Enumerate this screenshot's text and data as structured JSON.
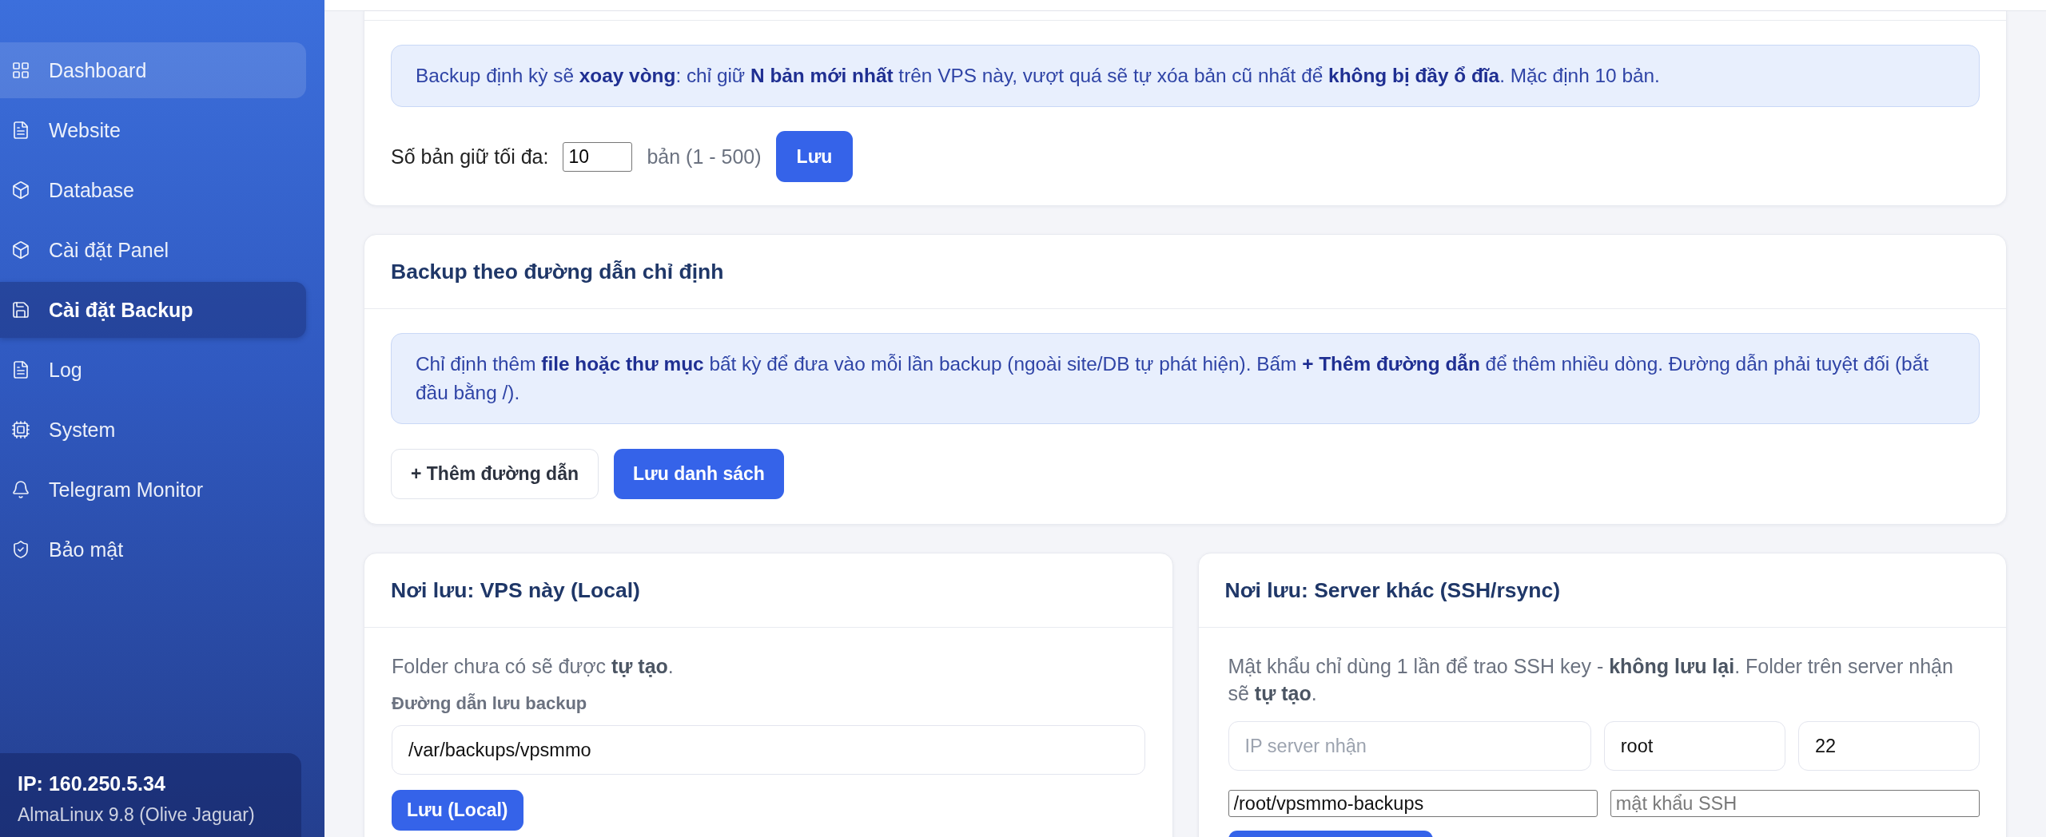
{
  "sidebar": {
    "items": [
      {
        "label": "Dashboard",
        "selected": false,
        "hovered": true
      },
      {
        "label": "Website",
        "selected": false,
        "hovered": false
      },
      {
        "label": "Database",
        "selected": false,
        "hovered": false
      },
      {
        "label": "Cài đặt Panel",
        "selected": false,
        "hovered": false
      },
      {
        "label": "Cài đặt Backup",
        "selected": true,
        "hovered": false
      },
      {
        "label": "Log",
        "selected": false,
        "hovered": false
      },
      {
        "label": "System",
        "selected": false,
        "hovered": false
      },
      {
        "label": "Telegram Monitor",
        "selected": false,
        "hovered": false
      },
      {
        "label": "Bảo mật",
        "selected": false,
        "hovered": false
      }
    ],
    "server_info": {
      "ip": "IP: 160.250.5.34",
      "os": "AlmaLinux 9.8 (Olive Jaguar)"
    }
  },
  "retention_card": {
    "notice": "Backup định kỳ sẽ **xoay vòng**: chỉ giữ **N bản mới nhất** trên VPS này, vượt quá sẽ tự xóa bản cũ nhất để **không bị đầy ổ đĩa**. Mặc định 10 bản.",
    "label": "Số bản giữ tối đa:",
    "input": {
      "value": "10"
    },
    "hint": "bản (1 - 500)",
    "button": "Lưu"
  },
  "custom_paths_card": {
    "title": "Backup theo đường dẫn chỉ định",
    "notice": "Chỉ định thêm **file hoặc thư mục** bất kỳ để đưa vào mỗi lần backup (ngoài site/DB tự phát hiện). Bấm **+ Thêm đường dẫn** để thêm nhiều dòng. Đường dẫn phải tuyệt đối (bắt đầu bằng /).",
    "buttons": [
      {
        "label": "+ Thêm đường dẫn",
        "kind": "secondary"
      },
      {
        "label": "Lưu danh sách",
        "kind": "primary"
      }
    ]
  },
  "local_card": {
    "title": "Nơi lưu: VPS này (Local)",
    "note": "Folder chưa có sẽ được **tự tạo**.",
    "field_label": "Đường dẫn lưu backup",
    "field": {
      "value": "/var/backups/vpsmmo"
    },
    "button": "Lưu (Local)"
  },
  "remote_card": {
    "title": "Nơi lưu: Server khác (SSH/rsync)",
    "note": "Mật khẩu chỉ dùng 1 lần để trao SSH key - **không lưu lại**. Folder trên server nhận sẽ **tự tạo**.",
    "fields": [
      {
        "placeholder": "IP server nhận",
        "kind": "rounded"
      },
      {
        "value": "root",
        "kind": "rounded"
      },
      {
        "value": "22",
        "kind": "rounded"
      },
      {
        "value": "/root/vpsmmo-backups",
        "kind": "boxed"
      },
      {
        "placeholder": "mật khẩu SSH",
        "kind": "boxed"
      }
    ]
  }
}
